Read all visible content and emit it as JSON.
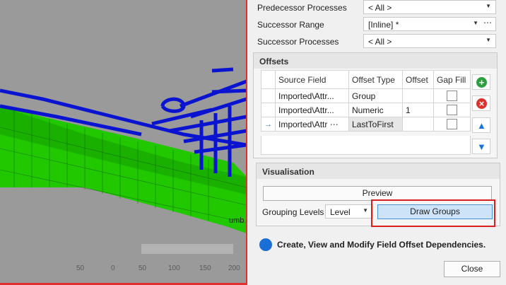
{
  "viewport": {
    "axis_ticks": [
      "50",
      "0",
      "50",
      "100",
      "150",
      "200"
    ],
    "label_fragment": "umb"
  },
  "fields": {
    "predecessor_processes": {
      "label": "Predecessor Processes",
      "value": "< All >"
    },
    "successor_range": {
      "label": "Successor Range",
      "value": "[Inline] *"
    },
    "successor_processes": {
      "label": "Successor Processes",
      "value": "< All >"
    }
  },
  "offsets": {
    "title": "Offsets",
    "columns": [
      "Source Field",
      "Offset Type",
      "Offset",
      "Gap Fill"
    ],
    "rows": [
      {
        "source": "Imported\\Attr...",
        "type": "Group",
        "offset": "",
        "gap_fill": false
      },
      {
        "source": "Imported\\Attr...",
        "type": "Numeric",
        "offset": "1",
        "gap_fill": false
      },
      {
        "source": "Imported\\Attr",
        "type": "LastToFirst",
        "offset": "",
        "gap_fill": false
      }
    ],
    "current_row_marker": "→",
    "ellipsis": "⋯",
    "buttons": {
      "add": "+",
      "remove": "×",
      "up": "▲",
      "down": "▼"
    }
  },
  "visualisation": {
    "title": "Visualisation",
    "preview_label": "Preview",
    "grouping_levels_label": "Grouping Levels",
    "grouping_levels_value": "Level",
    "draw_groups_label": "Draw Groups"
  },
  "info_text": "Create, View and Modify Field Offset Dependencies.",
  "close_label": "Close",
  "colors": {
    "accent": "#1a73d9",
    "highlight": "#e02020",
    "mesh_green": "#22cc00",
    "mesh_blue": "#0a14d0"
  }
}
